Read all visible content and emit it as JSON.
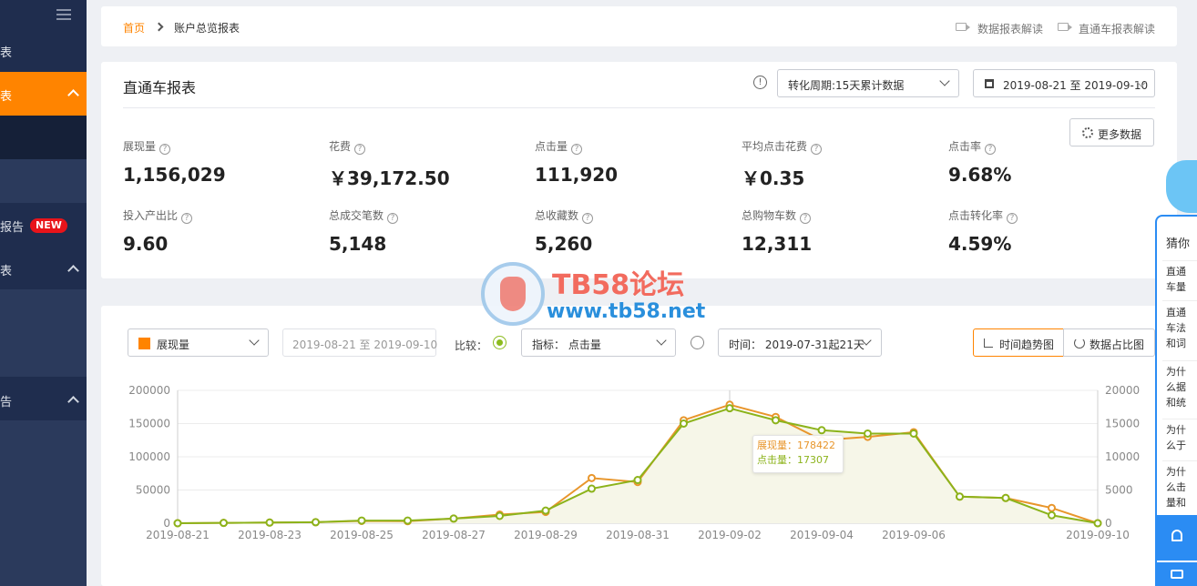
{
  "sidebar": {
    "items": [
      {
        "label": "表"
      },
      {
        "label": "表"
      },
      {
        "label": "报告"
      },
      {
        "label": "表"
      },
      {
        "label": "告"
      }
    ],
    "new_badge": "NEW"
  },
  "breadcrumb": {
    "home": "首页",
    "current": "账户总览报表"
  },
  "header_links": {
    "data_report": "数据报表解读",
    "ztc_report": "直通车报表解读"
  },
  "panel": {
    "title": "直通车报表",
    "period_select": "转化周期:15天累计数据",
    "date_range": "2019-08-21 至 2019-09-10",
    "more_button": "更多数据"
  },
  "metrics": [
    {
      "label": "展现量",
      "value": "1,156,029"
    },
    {
      "label": "花费",
      "value": "￥39,172.50"
    },
    {
      "label": "点击量",
      "value": "111,920"
    },
    {
      "label": "平均点击花费",
      "value": "￥0.35"
    },
    {
      "label": "点击率",
      "value": "9.68%"
    },
    {
      "label": "投入产出比",
      "value": "9.60"
    },
    {
      "label": "总成交笔数",
      "value": "5,148"
    },
    {
      "label": "总收藏数",
      "value": "5,260"
    },
    {
      "label": "总购物车数",
      "value": "12,311"
    },
    {
      "label": "点击转化率",
      "value": "4.59%"
    }
  ],
  "chart_controls": {
    "metric_select": "展现量",
    "date_range": "2019-08-21 至 2019-09-10",
    "compare_label": "比较：",
    "indicator_select": "指标： 点击量",
    "time_select": "时间： 2019-07-31起21天",
    "trend_button": "时间趋势图",
    "share_button": "数据占比图"
  },
  "watermark": {
    "title": "TB58论坛",
    "url": "www.tb58.net"
  },
  "tooltip": {
    "line1": "展现量：178422",
    "line2": "点击量：17307"
  },
  "right_widget": {
    "header": "猜你",
    "items": [
      "直通车量曝光",
      "直通车法和词核对",
      "为什么据和统一致",
      "为什么于出价",
      "为什么击量和不一致"
    ]
  },
  "colors": {
    "accent": "#ff8400",
    "series_impressions": "#e8962c",
    "series_clicks": "#8cb31b",
    "sidebar": "#1f2d4e"
  },
  "chart_data": {
    "type": "line",
    "x": [
      "2019-08-21",
      "2019-08-22",
      "2019-08-23",
      "2019-08-24",
      "2019-08-25",
      "2019-08-26",
      "2019-08-27",
      "2019-08-28",
      "2019-08-29",
      "2019-08-30",
      "2019-08-31",
      "2019-09-01",
      "2019-09-02",
      "2019-09-03",
      "2019-09-04",
      "2019-09-05",
      "2019-09-06",
      "2019-09-07",
      "2019-09-08",
      "2019-09-09",
      "2019-09-10"
    ],
    "x_ticks": [
      "2019-08-21",
      "2019-08-23",
      "2019-08-25",
      "2019-08-27",
      "2019-08-29",
      "2019-08-31",
      "2019-09-02",
      "2019-09-04",
      "2019-09-06",
      "2019-09-10"
    ],
    "series": [
      {
        "name": "展现量",
        "axis": "left",
        "values": [
          0,
          500,
          1000,
          1500,
          3500,
          3000,
          7000,
          13000,
          17000,
          68000,
          62000,
          155000,
          178422,
          160000,
          125000,
          130000,
          137000,
          40000,
          38000,
          23000,
          0
        ]
      },
      {
        "name": "点击量",
        "axis": "right",
        "values": [
          0,
          50,
          100,
          150,
          400,
          400,
          700,
          1100,
          1900,
          5200,
          6500,
          15000,
          17307,
          15500,
          14000,
          13500,
          13500,
          4000,
          3800,
          1200,
          0
        ]
      }
    ],
    "ylim_left": [
      0,
      200000
    ],
    "ylim_right": [
      0,
      20000
    ],
    "yticks_left": [
      "0",
      "50000",
      "100000",
      "150000",
      "200000"
    ],
    "yticks_right": [
      "0",
      "5000",
      "10000",
      "15000",
      "20000"
    ],
    "grid": true,
    "highlight_index": 12
  }
}
